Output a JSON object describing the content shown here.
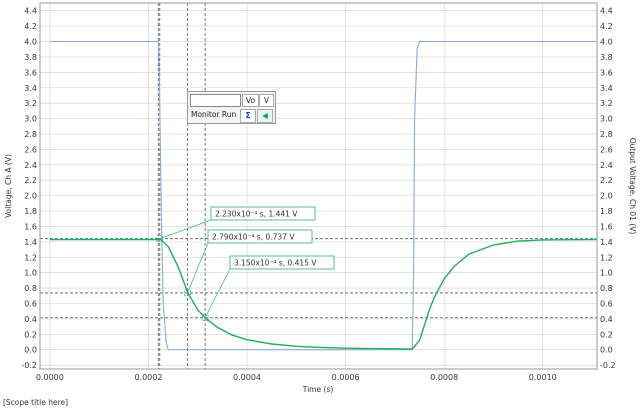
{
  "scope_title": "[Scope title here]",
  "monitor": {
    "value": "",
    "channel": "Vo",
    "unit": "V",
    "run_label": "Monitor Run",
    "sigma_icon": "sigma-icon",
    "arrow_icon": "left-arrow-icon"
  },
  "chart_data": {
    "type": "line",
    "xlabel": "Time (s)",
    "ylabel_left": "Voltage, Ch A (V)",
    "ylabel_right": "Output Voltage, Ch 01 (V)",
    "xlim": [
      -2e-05,
      0.00111
    ],
    "ylim": [
      -0.25,
      4.5
    ],
    "x_ticks": [
      0.0,
      0.0002,
      0.0004,
      0.0006,
      0.0008,
      0.001
    ],
    "x_tick_labels": [
      "0.0000",
      "0.0002",
      "0.0004",
      "0.0006",
      "0.0008",
      "0.0010"
    ],
    "y_ticks": [
      -0.2,
      0.0,
      0.2,
      0.4,
      0.6,
      0.8,
      1.0,
      1.2,
      1.4,
      1.6,
      1.8,
      2.0,
      2.2,
      2.4,
      2.6,
      2.8,
      3.0,
      3.2,
      3.4,
      3.6,
      3.8,
      4.0,
      4.2,
      4.4
    ],
    "y_tick_labels": [
      "-0.2",
      "0.0",
      "0.2",
      "0.4",
      "0.6",
      "0.8",
      "1.0",
      "1.2",
      "1.4",
      "1.6",
      "1.8",
      "2.0",
      "2.2",
      "2.4",
      "2.6",
      "2.8",
      "3.0",
      "3.2",
      "3.4",
      "3.6",
      "3.8",
      "4.0",
      "4.2",
      "4.4"
    ],
    "grid": true,
    "colors": {
      "input": "#8aa8e0",
      "output": "#1fae5e",
      "grid": "#d0d0d0",
      "cursor": "#555555"
    },
    "series": [
      {
        "x": [
          0.0,
          0.00022,
          0.000222,
          0.000226,
          0.00023,
          0.000236,
          0.00024,
          0.000735,
          0.000738,
          0.00074,
          0.000745,
          0.00075,
          0.00111
        ],
        "y": [
          4.0,
          4.0,
          3.6,
          1.8,
          0.6,
          0.1,
          0.0,
          0.0,
          1.0,
          3.0,
          3.9,
          4.0,
          4.0
        ]
      },
      {
        "x": [
          0.0,
          0.00022,
          0.000223,
          0.00024,
          0.00026,
          0.00028,
          0.0003,
          0.000315,
          0.00034,
          0.00037,
          0.0004,
          0.00045,
          0.0005,
          0.00055,
          0.0006,
          0.00065,
          0.0007,
          0.000735,
          0.00075,
          0.00076,
          0.00077,
          0.00078,
          0.0008,
          0.00082,
          0.00085,
          0.0009,
          0.00095,
          0.001,
          0.00111
        ],
        "y": [
          1.43,
          1.43,
          1.441,
          1.34,
          1.08,
          0.737,
          0.52,
          0.415,
          0.29,
          0.19,
          0.13,
          0.075,
          0.045,
          0.03,
          0.02,
          0.015,
          0.012,
          0.01,
          0.12,
          0.32,
          0.52,
          0.68,
          0.92,
          1.08,
          1.24,
          1.36,
          1.41,
          1.425,
          1.43
        ]
      }
    ],
    "vertical_cursors": [
      0.00022,
      0.000223,
      0.000279,
      0.000315
    ],
    "horizontal_cursors": [
      1.441,
      0.737,
      0.415
    ],
    "annotations": [
      {
        "label": "2.230x10⁻⁴ s, 1.441 V",
        "x": 0.000223,
        "y": 1.441
      },
      {
        "label": "2.790x10⁻⁴ s, 0.737 V",
        "x": 0.000279,
        "y": 0.737
      },
      {
        "label": "3.150x10⁻⁴ s, 0.415 V",
        "x": 0.000315,
        "y": 0.415
      }
    ]
  }
}
